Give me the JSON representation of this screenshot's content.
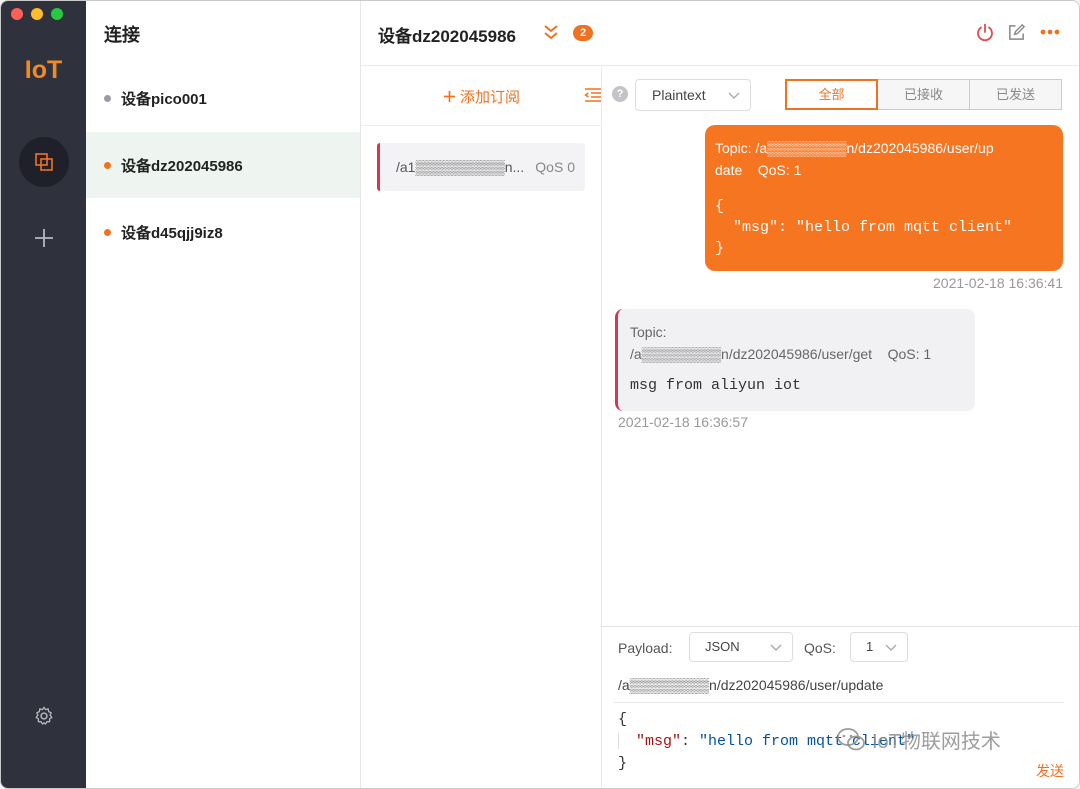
{
  "window": {
    "colors": {
      "accent": "#f07220",
      "rail": "#2f313c",
      "outgoing": "#f57521",
      "incoming_border": "#d03a5a"
    }
  },
  "rail": {
    "logo": "IoT",
    "icons": [
      "connections-icon",
      "plus-icon",
      "gear-icon"
    ]
  },
  "connections": {
    "title": "连接",
    "items": [
      {
        "label": "设备pico001",
        "status": "gray"
      },
      {
        "label": "设备dz202045986",
        "status": "orange"
      },
      {
        "label": "设备d45qjj9iz8",
        "status": "orange"
      }
    ]
  },
  "header": {
    "title": "设备dz202045986",
    "badge": "2"
  },
  "subscriptions": {
    "add_label": "添加订阅",
    "items": [
      {
        "topic": "/a1▒▒▒▒▒▒▒▒▒n...",
        "qos": "QoS 0"
      }
    ]
  },
  "messages": {
    "help": "?",
    "format": "Plaintext",
    "filters": [
      "全部",
      "已接收",
      "已发送"
    ],
    "active_filter": "全部",
    "list": [
      {
        "direction": "out",
        "topic_line1": "Topic: /a▒▒▒▒▒▒▒▒n/dz202045986/user/up",
        "topic_line2": "date",
        "qos": "QoS: 1",
        "payload": "{\n  \"msg\": \"hello from mqtt client\"\n}",
        "time": "2021-02-18 16:36:41"
      },
      {
        "direction": "in",
        "topic_label": "Topic:",
        "topic": "/a▒▒▒▒▒▒▒▒n/dz202045986/user/get",
        "qos": "QoS: 1",
        "payload": "msg from aliyun iot",
        "time": "2021-02-18 16:36:57"
      }
    ]
  },
  "composer": {
    "payload_label": "Payload:",
    "payload_format": "JSON",
    "qos_label": "QoS:",
    "qos_value": "1",
    "topic": "/a▒▒▒▒▒▒▒▒n/dz202045986/user/update",
    "editor": {
      "open": "{",
      "key": "\"msg\"",
      "colon": ": ",
      "value": "\"hello from mqtt client\"",
      "close": "}"
    },
    "send_label": "发送"
  },
  "watermark": "IoT物联网技术"
}
